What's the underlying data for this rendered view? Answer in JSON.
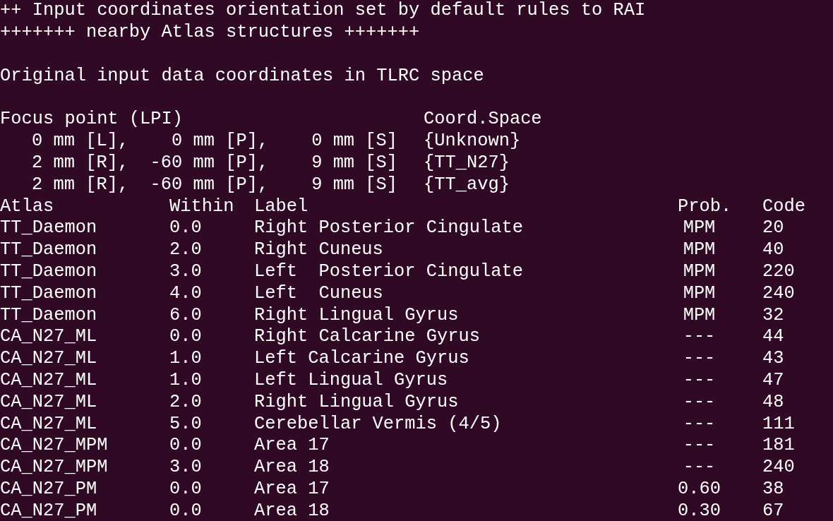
{
  "terminal": {
    "messages": [
      "++ Input coordinates orientation set by default rules to RAI",
      "+++++++ nearby Atlas structures +++++++",
      "Original input data coordinates in TLRC space"
    ],
    "focus_header": {
      "label": "Focus point (LPI)",
      "space": "Coord.Space"
    },
    "focus_rows": [
      {
        "coords": "0 mm [L],    0 mm [P],    0 mm [S]",
        "space": "{Unknown}"
      },
      {
        "coords": "2 mm [R],  -60 mm [P],    9 mm [S]",
        "space": "{TT_N27}"
      },
      {
        "coords": "2 mm [R],  -60 mm [P],    9 mm [S]",
        "space": "{TT_avg}"
      }
    ],
    "table": {
      "columns": [
        "Atlas",
        "Within",
        "Label",
        "Prob.",
        "Code"
      ],
      "rows": [
        [
          "TT_Daemon",
          "0.0",
          "Right Posterior Cingulate",
          "MPM",
          "20"
        ],
        [
          "TT_Daemon",
          "2.0",
          "Right Cuneus",
          "MPM",
          "40"
        ],
        [
          "TT_Daemon",
          "3.0",
          "Left  Posterior Cingulate",
          "MPM",
          "220"
        ],
        [
          "TT_Daemon",
          "4.0",
          "Left  Cuneus",
          "MPM",
          "240"
        ],
        [
          "TT_Daemon",
          "6.0",
          "Right Lingual Gyrus",
          "MPM",
          "32"
        ],
        [
          "CA_N27_ML",
          "0.0",
          "Right Calcarine Gyrus",
          "---",
          "44"
        ],
        [
          "CA_N27_ML",
          "1.0",
          "Left Calcarine Gyrus",
          "---",
          "43"
        ],
        [
          "CA_N27_ML",
          "1.0",
          "Left Lingual Gyrus",
          "---",
          "47"
        ],
        [
          "CA_N27_ML",
          "2.0",
          "Right Lingual Gyrus",
          "---",
          "48"
        ],
        [
          "CA_N27_ML",
          "5.0",
          "Cerebellar Vermis (4/5)",
          "---",
          "111"
        ],
        [
          "CA_N27_MPM",
          "0.0",
          "Area 17",
          "---",
          "181"
        ],
        [
          "CA_N27_MPM",
          "3.0",
          "Area 18",
          "---",
          "240"
        ],
        [
          "CA_N27_PM",
          "0.0",
          "Area 17",
          "0.60",
          "38"
        ],
        [
          "CA_N27_PM",
          "0.0",
          "Area 18",
          "0.30",
          "67"
        ]
      ]
    }
  }
}
